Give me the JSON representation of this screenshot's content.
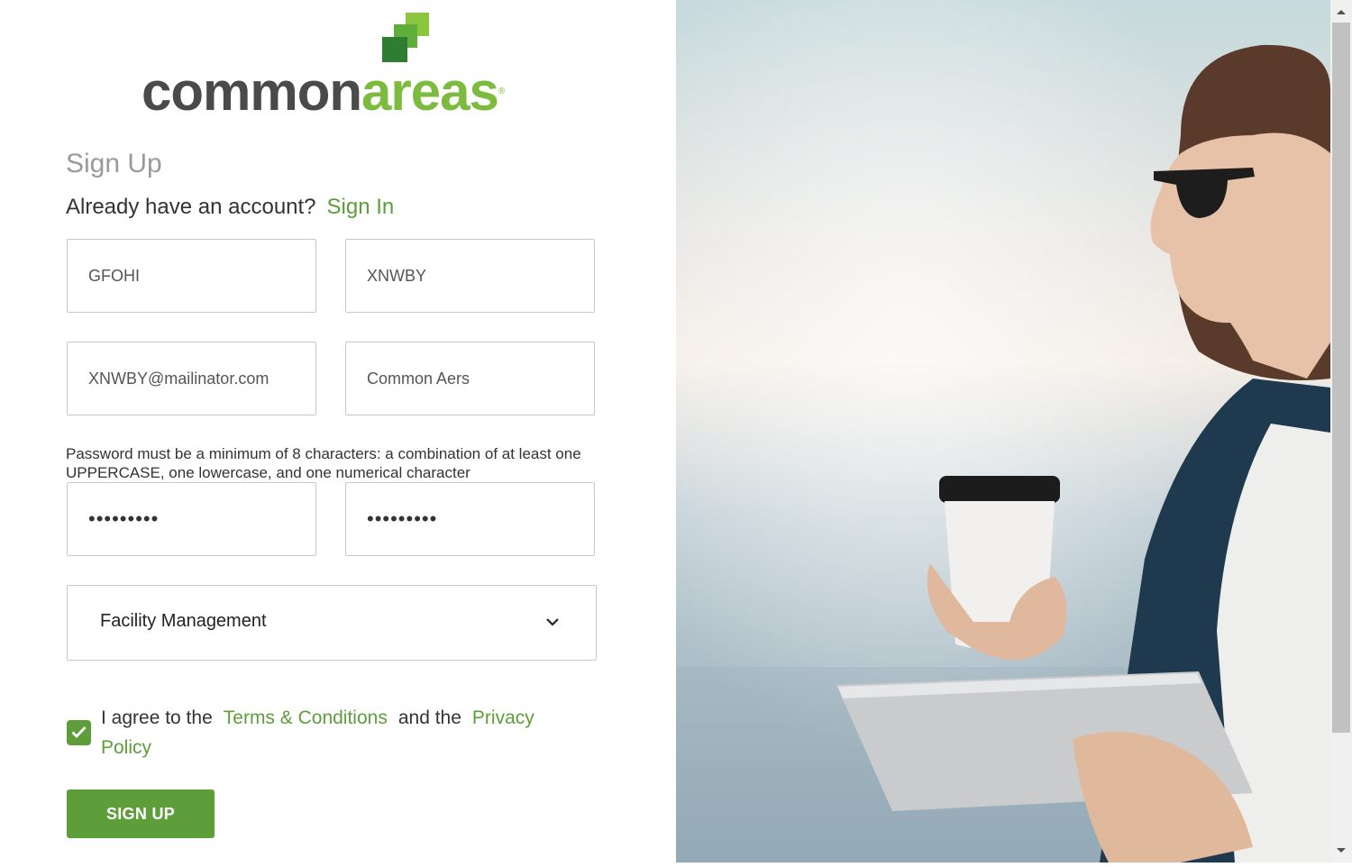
{
  "brand": {
    "name_part1": "common",
    "name_part2": "areas",
    "trademark": "®",
    "colors": {
      "gray": "#4a4a4a",
      "green": "#7dbb3f"
    }
  },
  "form": {
    "title": "Sign Up",
    "account_prompt": "Already have an account?",
    "sign_in_link": "Sign In",
    "first_name_value": "GFOHI",
    "last_name_value": "XNWBY",
    "email_value": "XNWBY@mailinator.com",
    "company_value": "Common Aers",
    "password_hint": "Password must be a minimum of 8 characters: a combination of at least one UPPERCASE, one lowercase, and one numerical character",
    "password_value": "•••••••••",
    "confirm_password_value": "•••••••••",
    "role_selected": "Facility Management",
    "agree_checked": true,
    "agree_prefix": "I agree to the",
    "terms_link": "Terms & Conditions",
    "agree_middle": "and the",
    "privacy_link": "Privacy Policy",
    "submit_label": "SIGN UP"
  },
  "icons": {
    "chevron": "chevron-down-icon",
    "check": "check-icon",
    "logo_mark": "logo-squares-icon"
  },
  "accent_color": "#5d9e3a"
}
